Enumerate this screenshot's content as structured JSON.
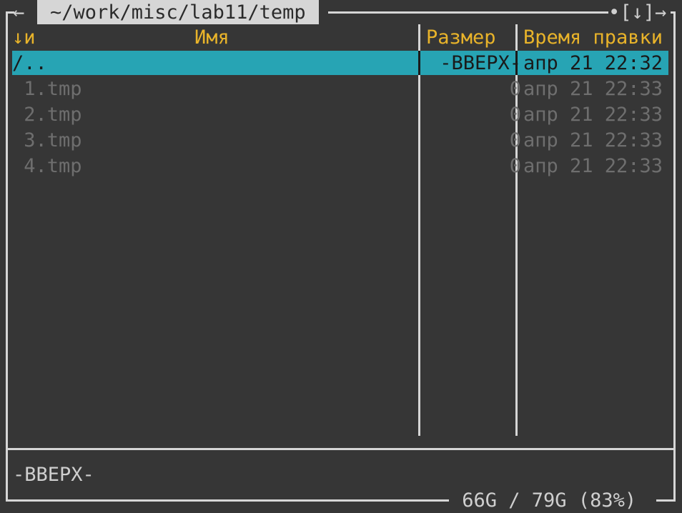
{
  "panel": {
    "path": "~/work/misc/lab11/temp",
    "left_arrow": "←",
    "right_controls": "•[↓]→"
  },
  "columns": {
    "sort_indicator": "↓и",
    "name": "Имя",
    "size": "Размер",
    "time": "Время правки"
  },
  "files": [
    {
      "name": "/..",
      "size": "-ВВЕРХ-",
      "time": "апр 21 22:32",
      "selected": true
    },
    {
      "name": " 1.tmp",
      "size": "0",
      "time": "апр 21 22:33",
      "selected": false
    },
    {
      "name": " 2.tmp",
      "size": "0",
      "time": "апр 21 22:33",
      "selected": false
    },
    {
      "name": " 3.tmp",
      "size": "0",
      "time": "апр 21 22:33",
      "selected": false
    },
    {
      "name": " 4.tmp",
      "size": "0",
      "time": "апр 21 22:33",
      "selected": false
    }
  ],
  "status": {
    "mini_info": "-ВВЕРХ-",
    "disk_usage": " 66G / 79G (83%) "
  },
  "colors": {
    "background": "#363636",
    "header_text": "#e8b32a",
    "selection": "#27a4b4",
    "frame": "#d6d6d6",
    "dim_text": "#6e6e6e"
  }
}
